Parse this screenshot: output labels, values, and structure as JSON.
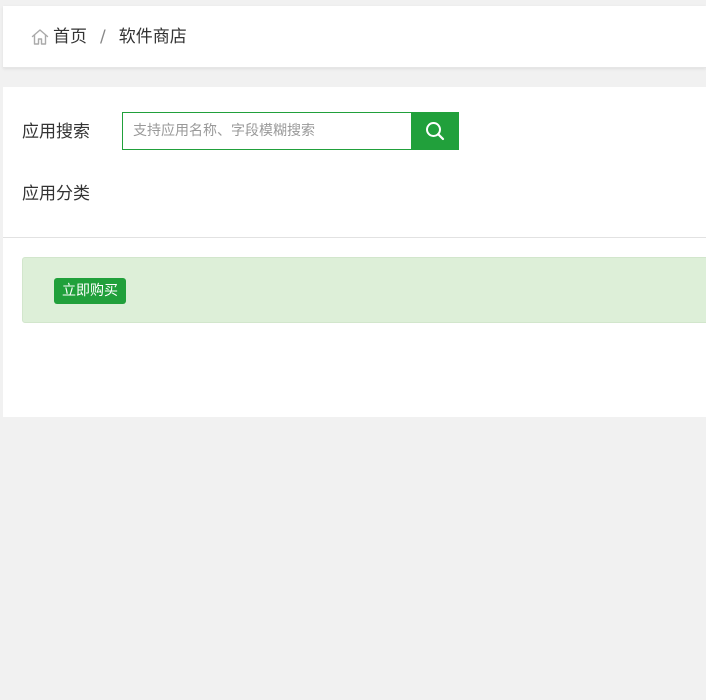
{
  "breadcrumb": {
    "home_icon": "home-icon",
    "home_label": "首页",
    "separator": "/",
    "current_label": "软件商店"
  },
  "search": {
    "label": "应用搜索",
    "placeholder": "支持应用名称、字段模糊搜索",
    "value": "",
    "button_icon": "search-icon"
  },
  "category": {
    "label": "应用分类"
  },
  "notice": {
    "buy_label": "立即购买"
  },
  "colors": {
    "accent": "#21a03b",
    "notice_bg": "#ddefd8",
    "page_bg": "#f1f1f1"
  }
}
